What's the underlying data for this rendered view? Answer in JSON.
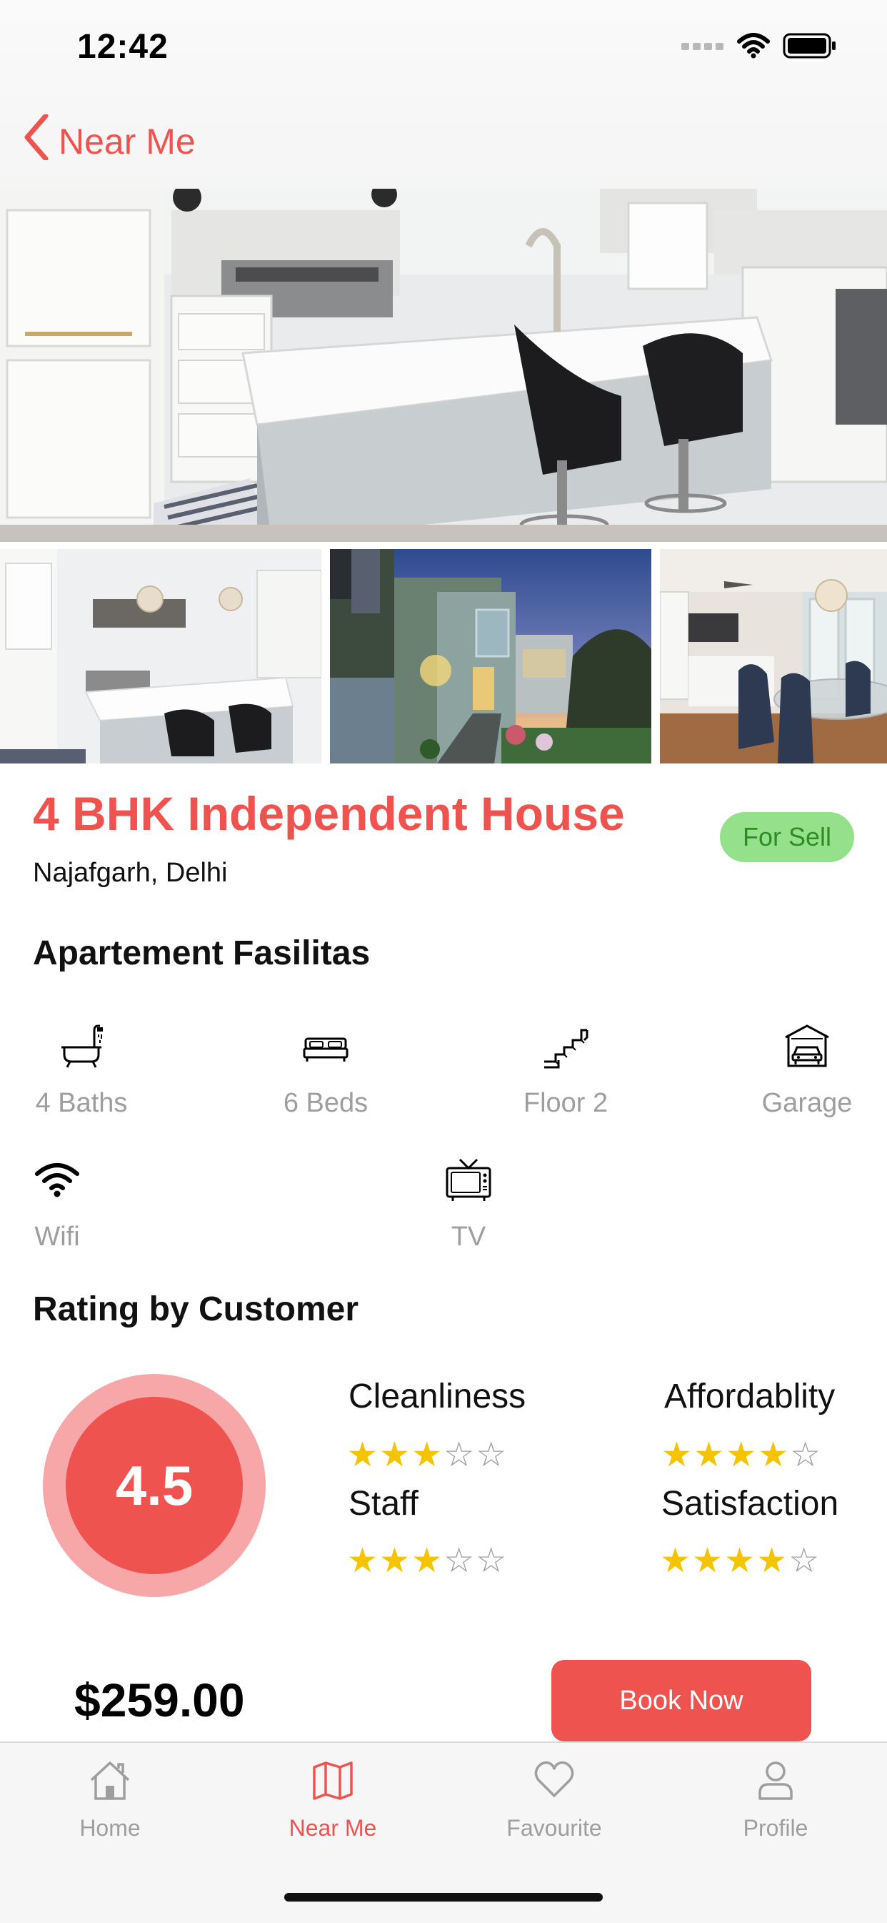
{
  "status_bar": {
    "time": "12:42"
  },
  "nav": {
    "back_label": "Near Me"
  },
  "listing": {
    "title": "4 BHK Independent House",
    "location": "Najafgarh, Delhi",
    "status": "For Sell"
  },
  "facilities": {
    "section_title": "Apartement Fasilitas",
    "items": [
      {
        "label": "4 Baths",
        "icon": "bathtub-icon"
      },
      {
        "label": "6 Beds",
        "icon": "bed-icon"
      },
      {
        "label": "Floor 2",
        "icon": "stairs-icon"
      },
      {
        "label": "Garage",
        "icon": "garage-icon"
      },
      {
        "label": "Wifi",
        "icon": "wifi-icon"
      },
      {
        "label": "TV",
        "icon": "tv-icon"
      }
    ]
  },
  "rating": {
    "section_title": "Rating by Customer",
    "overall": "4.5",
    "categories": [
      {
        "label": "Cleanliness",
        "stars": 3,
        "max": 5
      },
      {
        "label": "Affordablity",
        "stars": 4,
        "max": 5
      },
      {
        "label": "Staff",
        "stars": 3,
        "max": 5
      },
      {
        "label": "Satisfaction",
        "stars": 4,
        "max": 5
      }
    ]
  },
  "booking": {
    "price": "$259.00",
    "button_label": "Book Now"
  },
  "tabs": [
    {
      "label": "Home",
      "icon": "home-icon",
      "active": false
    },
    {
      "label": "Near Me",
      "icon": "map-icon",
      "active": true
    },
    {
      "label": "Favourite",
      "icon": "heart-icon",
      "active": false
    },
    {
      "label": "Profile",
      "icon": "person-icon",
      "active": false
    }
  ],
  "colors": {
    "accent": "#ef5350",
    "badge_bg": "#95e08a",
    "badge_text": "#2f8c24",
    "star": "#f5c400"
  }
}
